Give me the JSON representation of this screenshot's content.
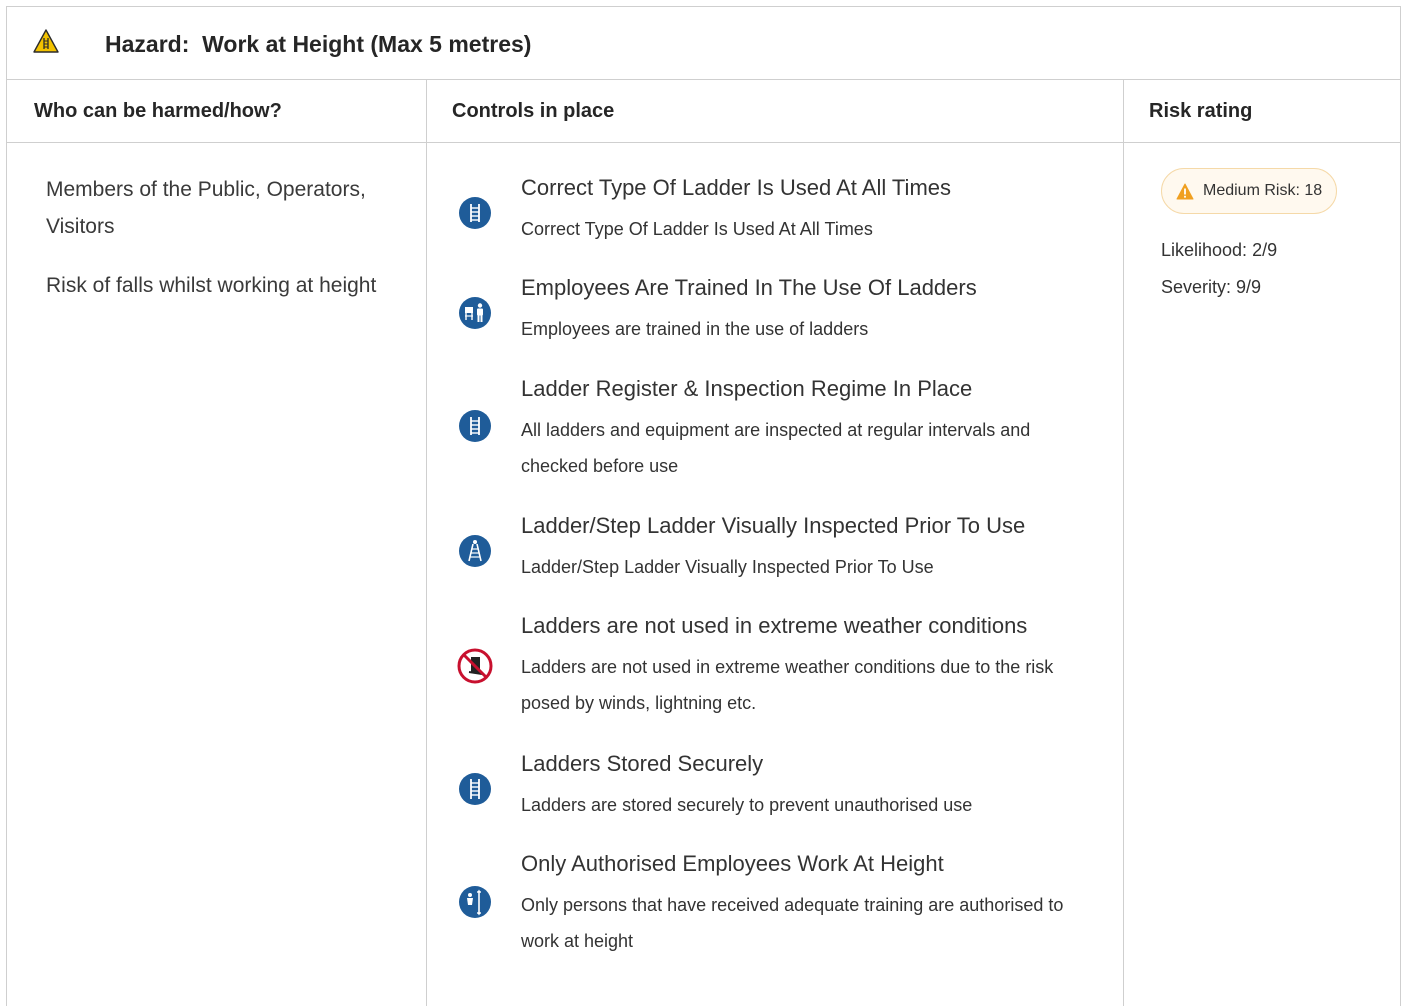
{
  "hazard": {
    "icon": "ladder-warning-icon",
    "title": "Hazard:  Work at Height (Max 5 metres)"
  },
  "columns": {
    "who": "Who can be harmed/how?",
    "controls": "Controls in place",
    "risk": "Risk rating"
  },
  "who": {
    "people": "Members of the Public, Operators, Visitors",
    "how": "Risk of falls whilst working at height"
  },
  "controls": [
    {
      "icon": "ladder-icon",
      "title": "Correct Type Of Ladder Is Used At All Times",
      "description": "Correct Type Of Ladder Is Used At All Times"
    },
    {
      "icon": "training-icon",
      "title": "Employees Are Trained In The Use Of Ladders",
      "description": "Employees are trained in the use of ladders"
    },
    {
      "icon": "ladder-icon",
      "title": "Ladder Register & Inspection Regime In Place",
      "description": "All ladders and equipment are inspected at regular intervals and checked before use"
    },
    {
      "icon": "step-ladder-icon",
      "title": "Ladder/Step Ladder Visually Inspected Prior To Use",
      "description": "Ladder/Step Ladder Visually Inspected Prior To Use"
    },
    {
      "icon": "no-ladder-prohibition-icon",
      "title": "Ladders are not used in extreme weather conditions",
      "description": "Ladders are not used in extreme weather conditions due to the risk posed by winds, lightning etc."
    },
    {
      "icon": "ladder-icon",
      "title": "Ladders Stored Securely",
      "description": "Ladders are stored securely to prevent unauthorised use"
    },
    {
      "icon": "work-at-height-icon",
      "title": "Only Authorised Employees Work At Height",
      "description": "Only persons that have received adequate training are authorised to work at height"
    }
  ],
  "risk": {
    "badge": "Medium Risk: 18",
    "badge_icon": "warning-icon",
    "likelihood": "Likelihood: 2/9",
    "severity": "Severity: 9/9"
  },
  "colors": {
    "icon_blue": "#1f5c99",
    "prohibition_red": "#c8102e",
    "warning_orange": "#f0a020",
    "hazard_yellow": "#f2c200",
    "border": "#cfcfcf"
  }
}
